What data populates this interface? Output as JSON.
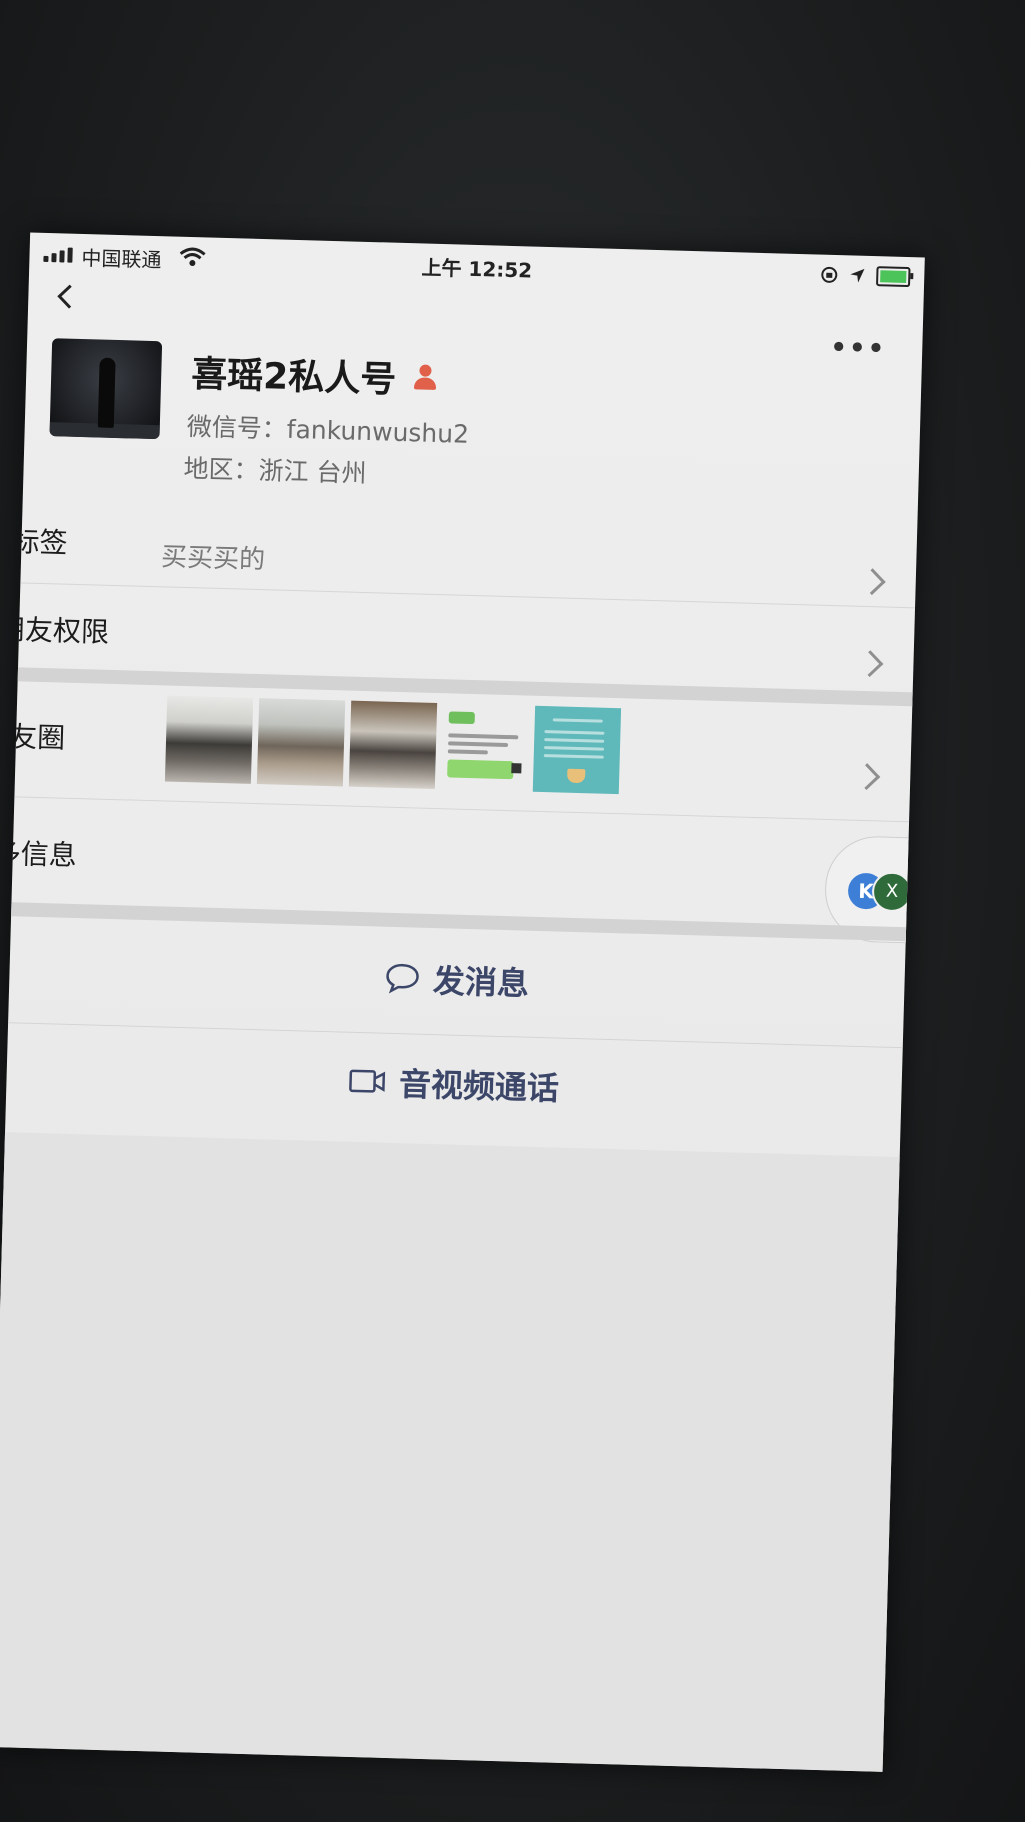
{
  "status_bar": {
    "carrier": "中国联通",
    "time": "上午 12:52"
  },
  "profile": {
    "name": "喜瑶2私人号",
    "wechat_id": "微信号：fankunwushu2",
    "region": "地区：浙江 台州"
  },
  "rows": {
    "tags_label": "标签",
    "tags_value": "买买买的",
    "friend_permissions_label": "朋友权限",
    "moments_label": "朋友圈",
    "more_info_label": "更多信息"
  },
  "actions": {
    "send_message": "发消息",
    "video_call": "音视频通话"
  },
  "floating": {
    "badge_letter": "X"
  },
  "icons": [
    "signal-icon",
    "wifi-icon",
    "battery-icon",
    "location-icon",
    "lock-rotation-icon",
    "back-icon",
    "more-icon",
    "person-icon",
    "chevron-right-icon",
    "message-icon",
    "video-icon"
  ],
  "colors": {
    "action_text": "#3c4668",
    "person_badge": "#e0604a",
    "battery_fill": "#4cc45a"
  }
}
